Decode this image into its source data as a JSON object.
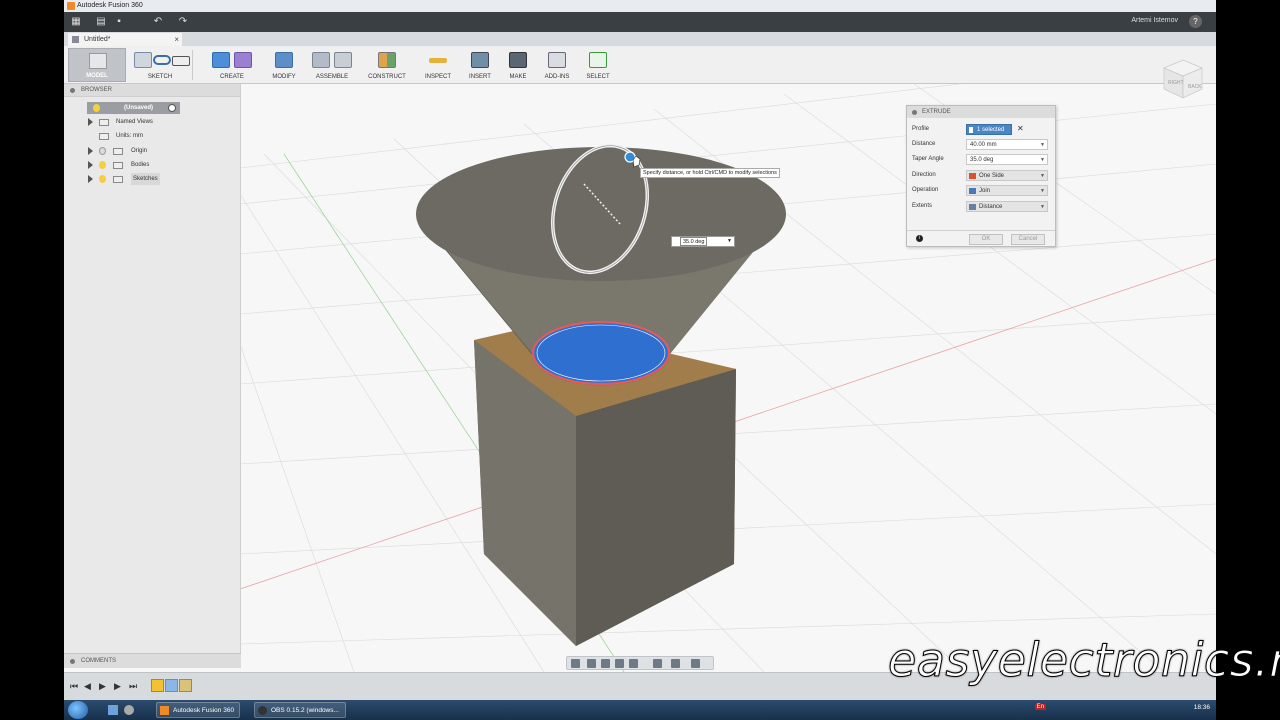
{
  "window": {
    "title": "Autodesk Fusion 360"
  },
  "header": {
    "user": "Artemi Istemov",
    "help": "?"
  },
  "document_tab": {
    "label": "Untitled*",
    "close": "×"
  },
  "toolbar": {
    "workspace": "MODEL",
    "groups": [
      "SKETCH",
      "CREATE",
      "MODIFY",
      "ASSEMBLE",
      "CONSTRUCT",
      "INSPECT",
      "INSERT",
      "MAKE",
      "ADD-INS",
      "SELECT"
    ]
  },
  "browser": {
    "title": "BROWSER",
    "root": "(Unsaved)",
    "items": [
      "Named Views",
      "Units: mm",
      "Origin",
      "Bodies",
      "Sketches"
    ]
  },
  "comments": {
    "title": "COMMENTS"
  },
  "viewcube": {
    "face_right": "BACK",
    "face_left": "RIGHT"
  },
  "extrude": {
    "title": "EXTRUDE",
    "profile_label": "Profile",
    "profile_value": "1 selected",
    "distance_label": "Distance",
    "distance_value": "40.00 mm",
    "taper_label": "Taper Angle",
    "taper_value": "35.0 deg",
    "direction_label": "Direction",
    "direction_value": "One Side",
    "operation_label": "Operation",
    "operation_value": "Join",
    "extents_label": "Extents",
    "extents_value": "Distance",
    "ok": "OK",
    "cancel": "Cancel"
  },
  "canvas": {
    "tooltip": "Specify distance, or hold Ctrl/CMD to modify selections",
    "angle_input": "35.0 deg"
  },
  "taskbar": {
    "items": [
      "Autodesk Fusion 360",
      "OBS 0.15.2 (windows..."
    ],
    "lang": "En",
    "clock": "18:36"
  },
  "watermark": "easyelectronics.ru"
}
